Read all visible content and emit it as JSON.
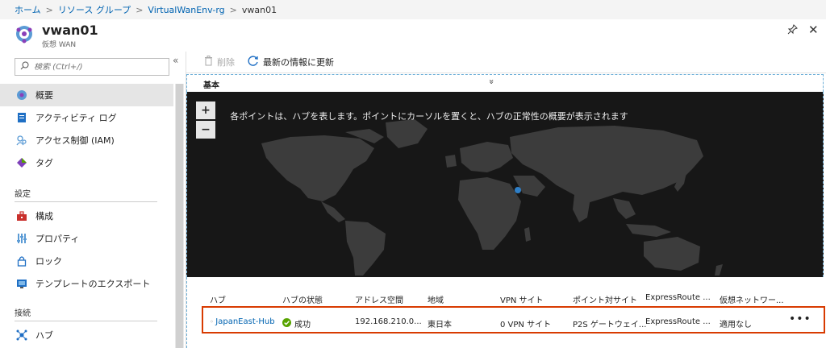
{
  "breadcrumb": {
    "items": [
      "ホーム",
      "リソース グループ",
      "VirtualWanEnv-rg"
    ],
    "current": "vwan01",
    "separator": ">"
  },
  "header": {
    "title": "vwan01",
    "subtitle": "仮想 WAN",
    "icon": "virtual-wan-icon",
    "pin_icon": "pin-icon",
    "close_icon": "close-icon"
  },
  "sidebar": {
    "search_placeholder": "検索 (Ctrl+/)",
    "collapse_glyph": "«",
    "items": [
      {
        "label": "概要",
        "icon": "overview-icon",
        "active": true
      },
      {
        "label": "アクティビティ ログ",
        "icon": "activity-log-icon"
      },
      {
        "label": "アクセス制御 (IAM)",
        "icon": "iam-icon"
      },
      {
        "label": "タグ",
        "icon": "tag-icon"
      }
    ],
    "section_settings": "設定",
    "settings_items": [
      {
        "label": "構成",
        "icon": "toolbox-icon"
      },
      {
        "label": "プロパティ",
        "icon": "properties-icon"
      },
      {
        "label": "ロック",
        "icon": "lock-icon"
      },
      {
        "label": "テンプレートのエクスポート",
        "icon": "export-template-icon"
      }
    ],
    "section_connect": "接続",
    "connect_items": [
      {
        "label": "ハブ",
        "icon": "hub-icon"
      }
    ]
  },
  "toolbar": {
    "delete_label": "削除",
    "refresh_label": "最新の情報に更新"
  },
  "essentials": {
    "label": "基本",
    "chevron": "»"
  },
  "map": {
    "zoom_in": "+",
    "zoom_out": "−",
    "note": "各ポイントは、ハブを表します。ポイントにカーソルを置くと、ハブの正常性の概要が表示されます"
  },
  "table": {
    "headers": [
      "ハブ",
      "ハブの状態",
      "アドレス空間",
      "地域",
      "VPN サイト",
      "ポイント対サイト",
      "ExpressRoute ...",
      "仮想ネットワー..."
    ],
    "rows": [
      {
        "hub": "JapanEast-Hub",
        "status": "成功",
        "address": "192.168.210.0...",
        "region": "東日本",
        "vpn": "0 VPN サイト",
        "p2s": "P2S ゲートウェイ...",
        "er": "ExpressRoute ...",
        "vnet": "適用なし",
        "more": "•••"
      }
    ]
  },
  "colors": {
    "link": "#0063b1",
    "highlight_border": "#d83b01",
    "success": "#57a300",
    "map_bg": "#171717",
    "hub_dot": "#2f7fc7"
  }
}
